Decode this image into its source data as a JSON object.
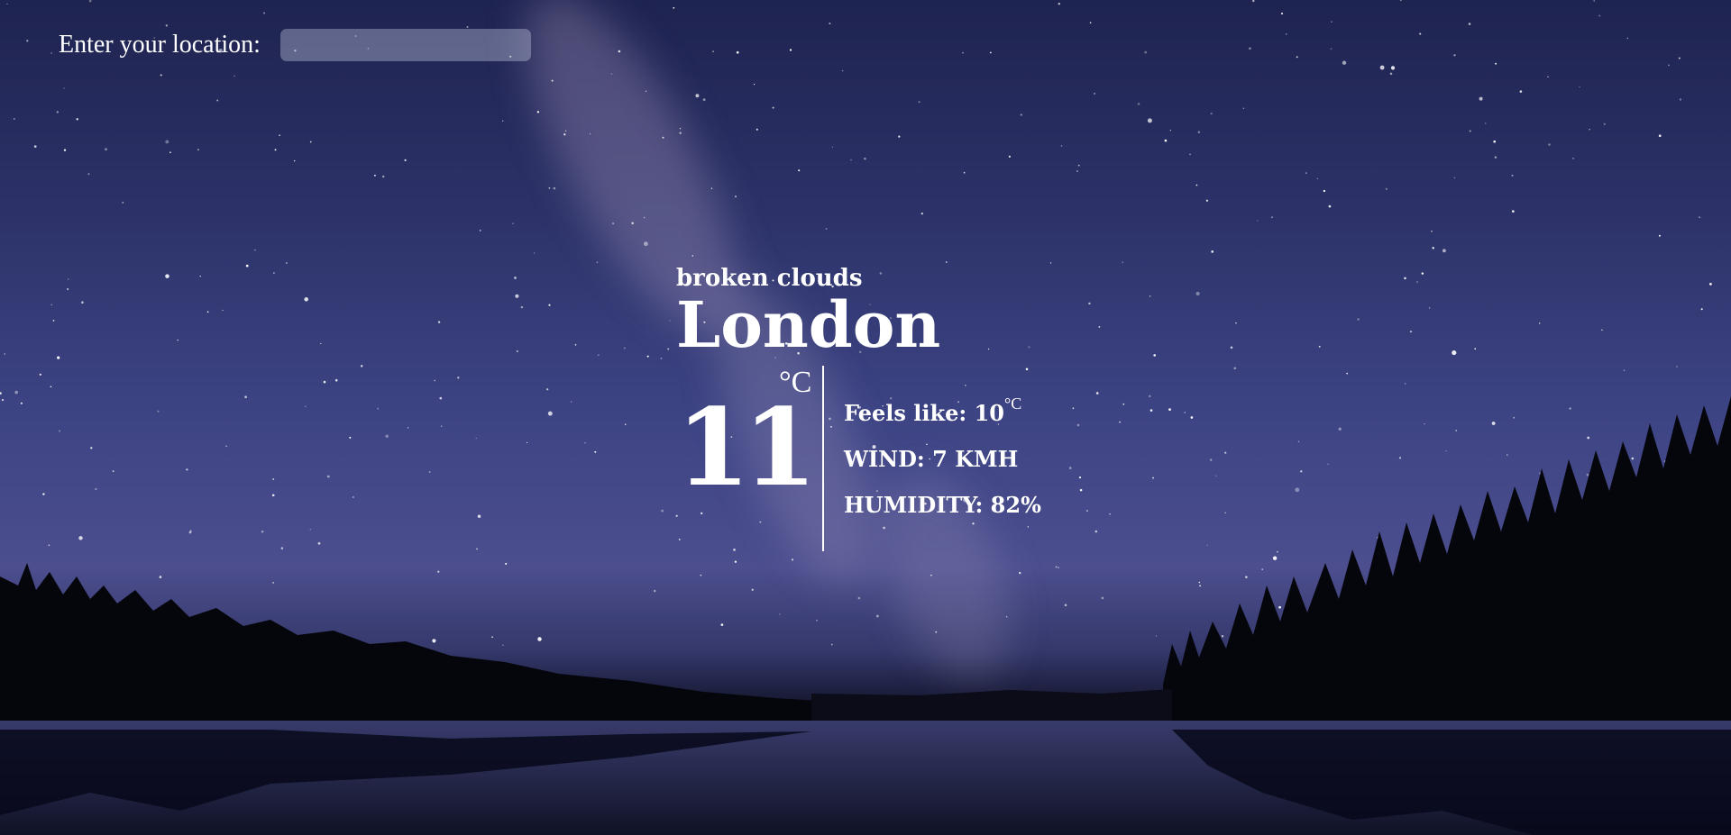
{
  "search": {
    "label": "Enter your location:",
    "value": "",
    "placeholder": ""
  },
  "weather": {
    "description": "broken clouds",
    "city": "London",
    "temperature": "11",
    "temperature_unit": "°C",
    "feels_like_label": "Feels like: 10",
    "feels_like_unit": "°C",
    "wind": "WIND: 7 KMH",
    "humidity": "HUMIDITY: 82%"
  },
  "background": {
    "scene": "starry night sky over lake with forest silhouette",
    "colors": {
      "sky_top": "#1e2350",
      "sky_mid": "#3d4484",
      "horizon": "#4c4e8e",
      "trees": "#05060c",
      "water": "#12142a"
    }
  }
}
